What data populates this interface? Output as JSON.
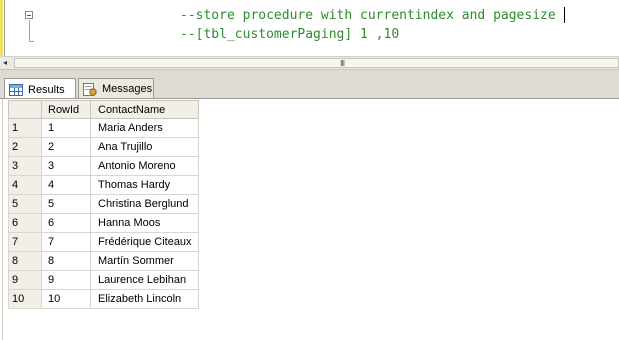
{
  "editor": {
    "lines": [
      "--store procedure with currentindex and pagesize",
      "--[tbl_customerPaging] 1 ,10"
    ],
    "comment_color": "#2e8b2e"
  },
  "scrollbar": {
    "left_arrow": "◂",
    "grip": "III"
  },
  "tabs": [
    {
      "label": "Results",
      "icon": "grid-icon",
      "active": true
    },
    {
      "label": "Messages",
      "icon": "messages-icon",
      "active": false
    }
  ],
  "grid": {
    "columns": [
      "RowId",
      "ContactName"
    ],
    "rows": [
      {
        "index": "1",
        "RowId": "1",
        "ContactName": "Maria Anders"
      },
      {
        "index": "2",
        "RowId": "2",
        "ContactName": "Ana Trujillo"
      },
      {
        "index": "3",
        "RowId": "3",
        "ContactName": "Antonio Moreno"
      },
      {
        "index": "4",
        "RowId": "4",
        "ContactName": "Thomas Hardy"
      },
      {
        "index": "5",
        "RowId": "5",
        "ContactName": "Christina Berglund"
      },
      {
        "index": "6",
        "RowId": "6",
        "ContactName": "Hanna Moos"
      },
      {
        "index": "7",
        "RowId": "7",
        "ContactName": "Frédérique Citeaux"
      },
      {
        "index": "8",
        "RowId": "8",
        "ContactName": "Martín Sommer"
      },
      {
        "index": "9",
        "RowId": "9",
        "ContactName": "Laurence Lebihan"
      },
      {
        "index": "10",
        "RowId": "10",
        "ContactName": "Elizabeth Lincoln"
      }
    ]
  }
}
